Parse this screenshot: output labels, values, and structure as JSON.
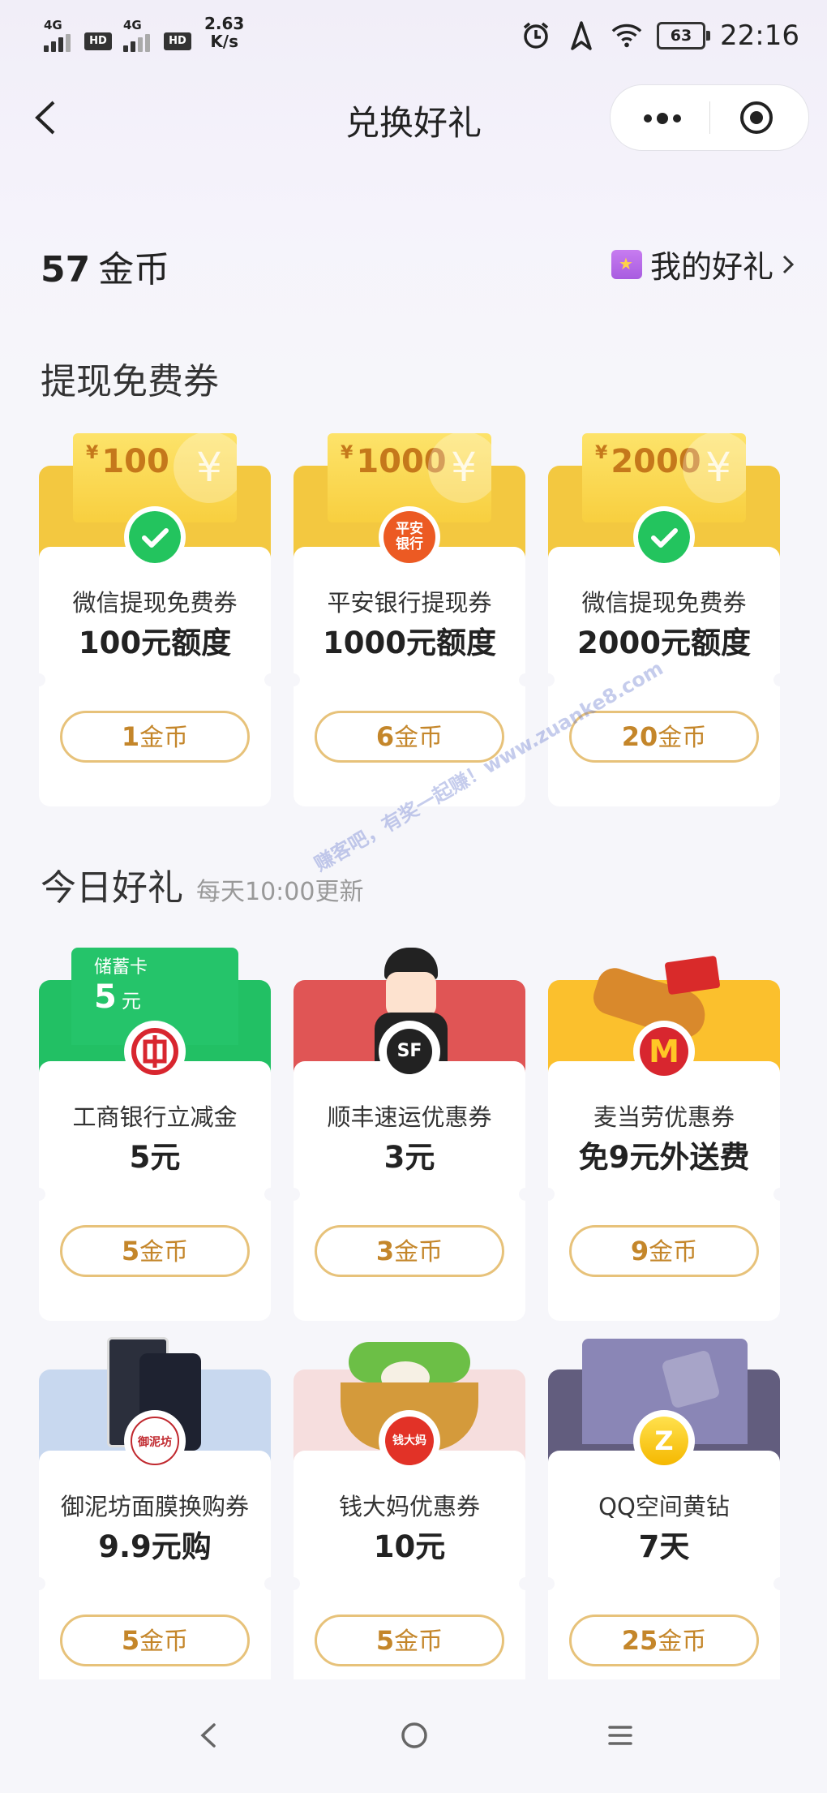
{
  "status_bar": {
    "sim1": "4G",
    "sim2": "4G",
    "hd1": "HD",
    "hd2": "HD",
    "net_speed_value": "2.63",
    "net_speed_unit": "K/s",
    "battery": "63",
    "time": "22:16"
  },
  "nav": {
    "title": "兑换好礼"
  },
  "coins": {
    "amount": "57",
    "unit": "金币"
  },
  "my_gifts": {
    "label": "我的好礼"
  },
  "sections": {
    "withdraw": {
      "title": "提现免费券"
    },
    "today": {
      "title": "今日好礼",
      "subtitle": "每天10:00更新"
    }
  },
  "withdraw_cards": [
    {
      "ticket_currency": "¥",
      "ticket_amount": "100",
      "logo": "wechat-pay-icon",
      "name": "微信提现免费券",
      "value": "100元额度",
      "price": "1",
      "price_unit": "金币"
    },
    {
      "ticket_currency": "¥",
      "ticket_amount": "1000",
      "logo": "pingan-bank-icon",
      "logo_text_1": "平安",
      "logo_text_2": "银行",
      "name": "平安银行提现券",
      "value": "1000元额度",
      "price": "6",
      "price_unit": "金币"
    },
    {
      "ticket_currency": "¥",
      "ticket_amount": "2000",
      "logo": "wechat-pay-icon",
      "name": "微信提现免费券",
      "value": "2000元额度",
      "price": "20",
      "price_unit": "金币"
    }
  ],
  "today_cards": [
    {
      "banner_label": "储蓄卡",
      "banner_amount": "5",
      "banner_unit": "元",
      "logo": "icbc-icon",
      "name": "工商银行立减金",
      "value": "5元",
      "price": "5",
      "price_unit": "金币"
    },
    {
      "logo": "sf-express-icon",
      "logo_text": "SF",
      "name": "顺丰速运优惠券",
      "value": "3元",
      "price": "3",
      "price_unit": "金币"
    },
    {
      "logo": "mcdonalds-icon",
      "logo_text": "M",
      "name": "麦当劳优惠券",
      "value": "免9元外送费",
      "price": "9",
      "price_unit": "金币"
    },
    {
      "logo": "yunifang-icon",
      "logo_text": "御泥坊",
      "name": "御泥坊面膜换购券",
      "value": "9.9元购",
      "price": "5",
      "price_unit": "金币"
    },
    {
      "logo": "qiandama-icon",
      "logo_text": "钱大妈",
      "name": "钱大妈优惠券",
      "value": "10元",
      "price": "5",
      "price_unit": "金币"
    },
    {
      "logo": "qq-zone-yellow-diamond-icon",
      "logo_text": "Z",
      "name": "QQ空间黄钻",
      "value": "7天",
      "price": "25",
      "price_unit": "金币"
    }
  ],
  "watermark": "赚客吧，有奖一起赚！www.zuanke8.com",
  "colors": {
    "gold_text": "#c4862a",
    "gold_border": "#e7c27a",
    "ticket_yellow": "#f8cf3f",
    "icbc_green": "#25c46a",
    "sf_red": "#e05555",
    "mcd_yellow": "#fbc02d"
  }
}
